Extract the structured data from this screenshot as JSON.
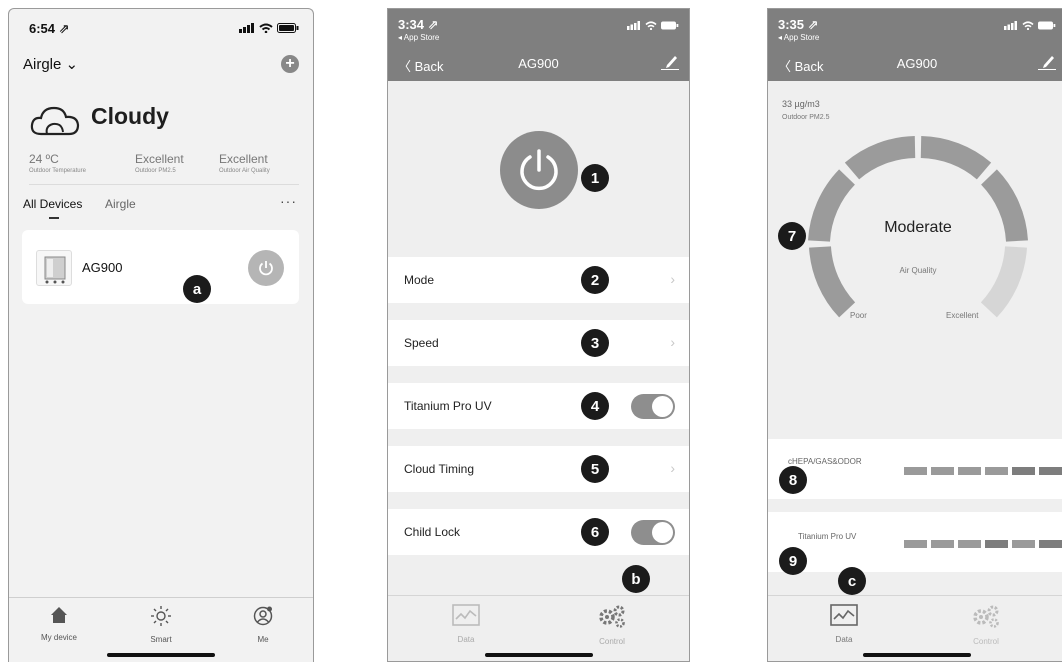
{
  "phone1": {
    "status": {
      "time": "6:54 ⇗"
    },
    "home": {
      "title": "Airgle ⌄"
    },
    "weather": {
      "condition": "Cloudy"
    },
    "stats": [
      {
        "value": "24 ºC",
        "label": "Outdoor Temperature"
      },
      {
        "value": "Excellent",
        "label": "Outdoor PM2.5"
      },
      {
        "value": "Excellent",
        "label": "Outdoor Air Quality"
      }
    ],
    "tabs": {
      "all": "All Devices",
      "airgle": "Airgle",
      "more": "···"
    },
    "device": {
      "name": "AG900"
    },
    "callout": "a",
    "tabbar": [
      {
        "icon": "home-icon",
        "label": "My device"
      },
      {
        "icon": "sun-icon",
        "label": "Smart"
      },
      {
        "icon": "profile-icon",
        "label": "Me"
      }
    ]
  },
  "phone2": {
    "status": {
      "time": "3:34 ⇗",
      "sub": "◂ App Store"
    },
    "nav": {
      "back": "〈 Back",
      "title": "AG900"
    },
    "power_callout": "1",
    "rows": [
      {
        "label": "Mode",
        "callout": "2",
        "control": "chevron",
        "chev": "›"
      },
      {
        "label": "Speed",
        "callout": "3",
        "control": "chevron",
        "chev": "›"
      },
      {
        "label": "Titanium Pro UV",
        "callout": "4",
        "control": "toggle"
      },
      {
        "label": "Cloud Timing",
        "callout": "5",
        "control": "chevron",
        "chev": "›"
      },
      {
        "label": "Child Lock",
        "callout": "6",
        "control": "toggle"
      }
    ],
    "callout_b": "b",
    "tabs": [
      {
        "icon": "chart-icon",
        "label": "Data"
      },
      {
        "icon": "gears-icon",
        "label": "Control"
      }
    ]
  },
  "phone3": {
    "status": {
      "time": "3:35 ⇗",
      "sub": "◂ App Store"
    },
    "nav": {
      "back": "〈 Back",
      "title": "AG900"
    },
    "pm": {
      "value": "33 µg/m3",
      "label": "Outdoor PM2.5"
    },
    "gauge": {
      "status": "Moderate",
      "label": "Air Quality",
      "low": "Poor",
      "high": "Excellent",
      "callout": "7"
    },
    "filters": [
      {
        "label": "cHEPA/GAS&ODOR",
        "callout": "8"
      },
      {
        "label": "Titanium Pro UV",
        "callout": "9"
      }
    ],
    "callout_c": "c",
    "tabs": [
      {
        "icon": "chart-icon",
        "label": "Data"
      },
      {
        "icon": "gears-icon",
        "label": "Control"
      }
    ]
  }
}
